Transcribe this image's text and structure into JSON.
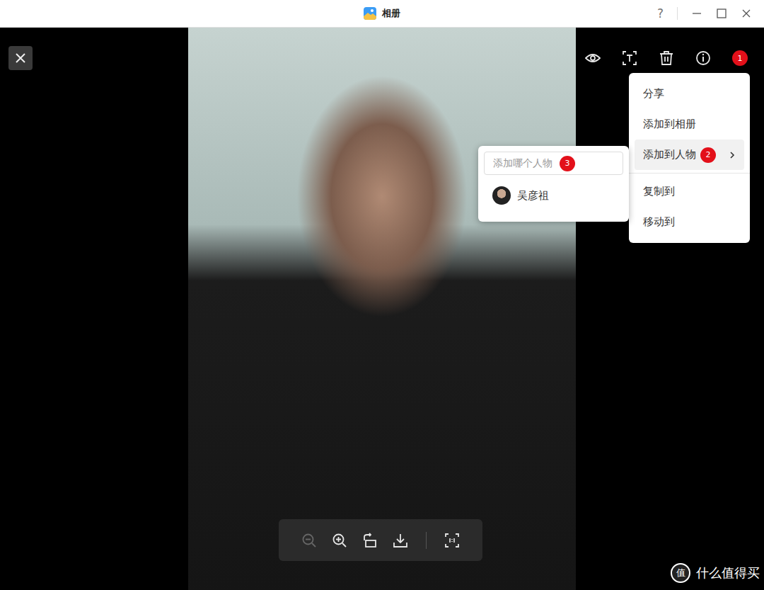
{
  "window": {
    "title": "相册",
    "help": "?"
  },
  "toolbar": {
    "badge": "1"
  },
  "menu": {
    "groups": [
      [
        {
          "label": "分享",
          "selected": false,
          "submenu": false,
          "badge": ""
        },
        {
          "label": "添加到相册",
          "selected": false,
          "submenu": false,
          "badge": ""
        },
        {
          "label": "添加到人物",
          "selected": true,
          "submenu": true,
          "badge": "2"
        }
      ],
      [
        {
          "label": "复制到",
          "selected": false,
          "submenu": false,
          "badge": ""
        },
        {
          "label": "移动到",
          "selected": false,
          "submenu": false,
          "badge": ""
        }
      ]
    ]
  },
  "submenu": {
    "placeholder": "添加哪个人物",
    "badge": "3",
    "people": [
      {
        "name": "吴彦祖"
      }
    ]
  },
  "bottom_toolbar": {
    "zoom_out": {
      "disabled": true
    },
    "zoom_in": {
      "disabled": false
    },
    "rotate": {
      "disabled": false
    },
    "download": {
      "disabled": false
    },
    "fit": {
      "disabled": false
    }
  },
  "watermark": {
    "logo": "值",
    "text": "什么值得买"
  }
}
